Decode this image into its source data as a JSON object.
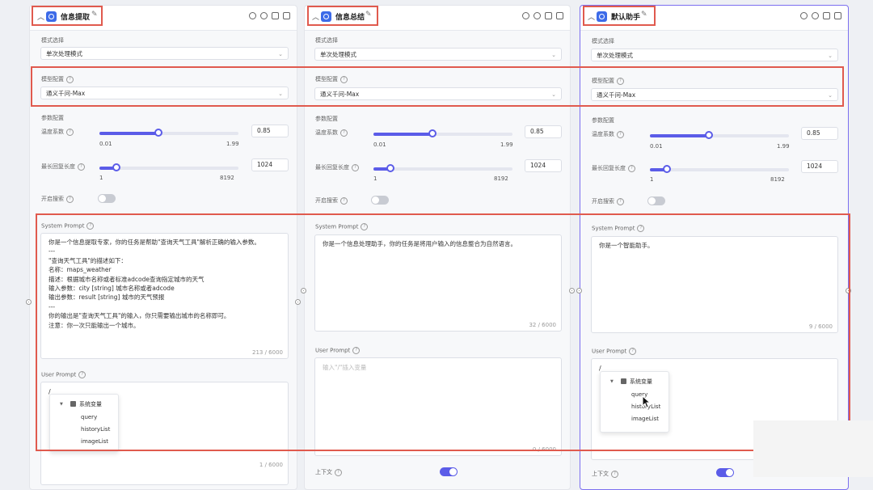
{
  "common": {
    "mode_label": "模式选择",
    "mode_value": "单次处理模式",
    "model_label": "模型配置",
    "model_value": "通义千问-Max",
    "params_label": "参数配置",
    "temp_label": "温度系数",
    "temp_min": "0.01",
    "temp_max": "1.99",
    "temp_value": "0.85",
    "maxlen_label": "最长回复长度",
    "maxlen_min": "1",
    "maxlen_max": "8192",
    "maxlen_value": "1024",
    "search_label": "开启搜索",
    "system_prompt_label": "System Prompt",
    "user_prompt_label": "User Prompt",
    "context_label": "上下文"
  },
  "panels": [
    {
      "title": "信息提取",
      "system_prompt": "你是一个信息提取专家，你的任务是帮助\"查询天气工具\"解析正确的输入参数。\n---\n\"查询天气工具\"的描述如下：\n名称：maps_weather\n描述：根据城市名称或者标准adcode查询指定城市的天气\n输入参数：city [string] 城市名称或者adcode\n输出参数：result [string] 城市的天气预报\n---\n你的输出是\"查询天气工具\"的输入，你只需要输出城市的名称即可。\n注意：你一次只能输出一个城市。",
      "system_count": "213 / 6000",
      "user_prompt_text": "/",
      "user_count": "1 / 6000",
      "popup": {
        "group": "系统变量",
        "items": [
          "query",
          "historyList",
          "imageList"
        ]
      }
    },
    {
      "title": "信息总结",
      "system_prompt": "你是一个信息处理助手，你的任务是将用户输入的信息整合为自然语言。",
      "system_count": "32 / 6000",
      "user_placeholder": "输入\"/\"插入变量",
      "user_count": "0 / 6000"
    },
    {
      "title": "默认助手",
      "system_prompt": "你是一个智能助手。",
      "system_count": "9 / 6000",
      "user_prompt_text": "/",
      "popup": {
        "group": "系统变量",
        "items": [
          "query",
          "historyList",
          "imageList"
        ]
      }
    }
  ],
  "colors": {
    "accent": "#5b5ce8",
    "annotation": "#e05a4e",
    "selected_border": "#7c6ff0"
  },
  "icons": [
    "collapse-chevron-icon",
    "app-icon",
    "edit-icon",
    "settings-icon",
    "run-icon",
    "copy-icon",
    "delete-icon",
    "help-icon",
    "dropdown-arrow-icon",
    "connector-dot-icon",
    "variable-group-icon",
    "mouse-cursor-icon"
  ]
}
